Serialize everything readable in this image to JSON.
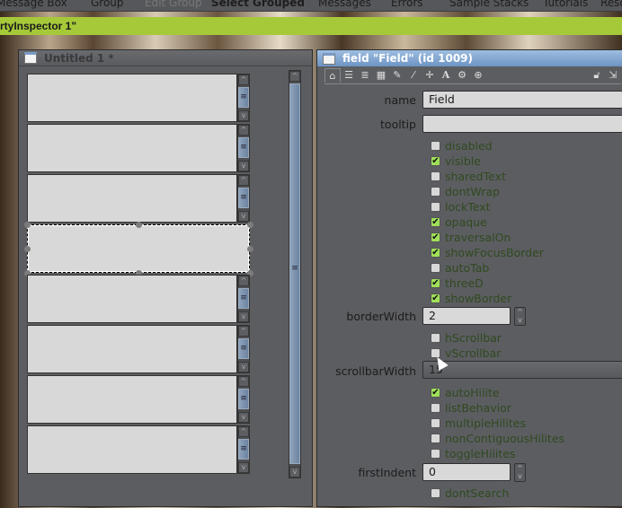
{
  "menubar": {
    "items": [
      "Message Box",
      "Group",
      "Edit Group",
      "Select Grouped",
      "Messages",
      "Errors",
      "Sample Stacks",
      "Tutorials",
      "Reso"
    ]
  },
  "greenbar": {
    "title": "rtyInspector 1\""
  },
  "stack_window": {
    "title": "Untitled 1 *",
    "field_count": 8,
    "selected_index": 3
  },
  "inspector": {
    "title": "field \"Field\" (id 1009)",
    "toolbar_icons": [
      "home-icon",
      "list-icon",
      "stack-icon",
      "table-icon",
      "pencil-icon",
      "wand-icon",
      "move-icon",
      "text-icon",
      "gears-icon",
      "geometry-icon",
      "lock-icon",
      "pop-out-icon"
    ],
    "name_label": "name",
    "name_value": "Field",
    "tooltip_label": "tooltip",
    "tooltip_value": "",
    "checks1": [
      {
        "label": "disabled",
        "checked": false
      },
      {
        "label": "visible",
        "checked": true
      },
      {
        "label": "sharedText",
        "checked": false
      },
      {
        "label": "dontWrap",
        "checked": false
      },
      {
        "label": "lockText",
        "checked": false
      },
      {
        "label": "opaque",
        "checked": true
      },
      {
        "label": "traversalOn",
        "checked": true
      },
      {
        "label": "showFocusBorder",
        "checked": true
      },
      {
        "label": "autoTab",
        "checked": false
      },
      {
        "label": "threeD",
        "checked": true
      },
      {
        "label": "showBorder",
        "checked": true
      }
    ],
    "borderWidth_label": "borderWidth",
    "borderWidth_value": "2",
    "checks2": [
      {
        "label": "hScrollbar",
        "checked": false
      },
      {
        "label": "vScrollbar",
        "checked": false
      }
    ],
    "scrollbarWidth_label": "scrollbarWidth",
    "scrollbarWidth_value": "15",
    "checks3": [
      {
        "label": "autoHilite",
        "checked": true
      },
      {
        "label": "listBehavior",
        "checked": false
      },
      {
        "label": "multipleHilites",
        "checked": false
      },
      {
        "label": "nonContiguousHilites",
        "checked": false
      },
      {
        "label": "toggleHilites",
        "checked": false
      }
    ],
    "firstIndent_label": "firstIndent",
    "firstIndent_value": "0",
    "checks4": [
      {
        "label": "dontSearch",
        "checked": false
      }
    ]
  }
}
